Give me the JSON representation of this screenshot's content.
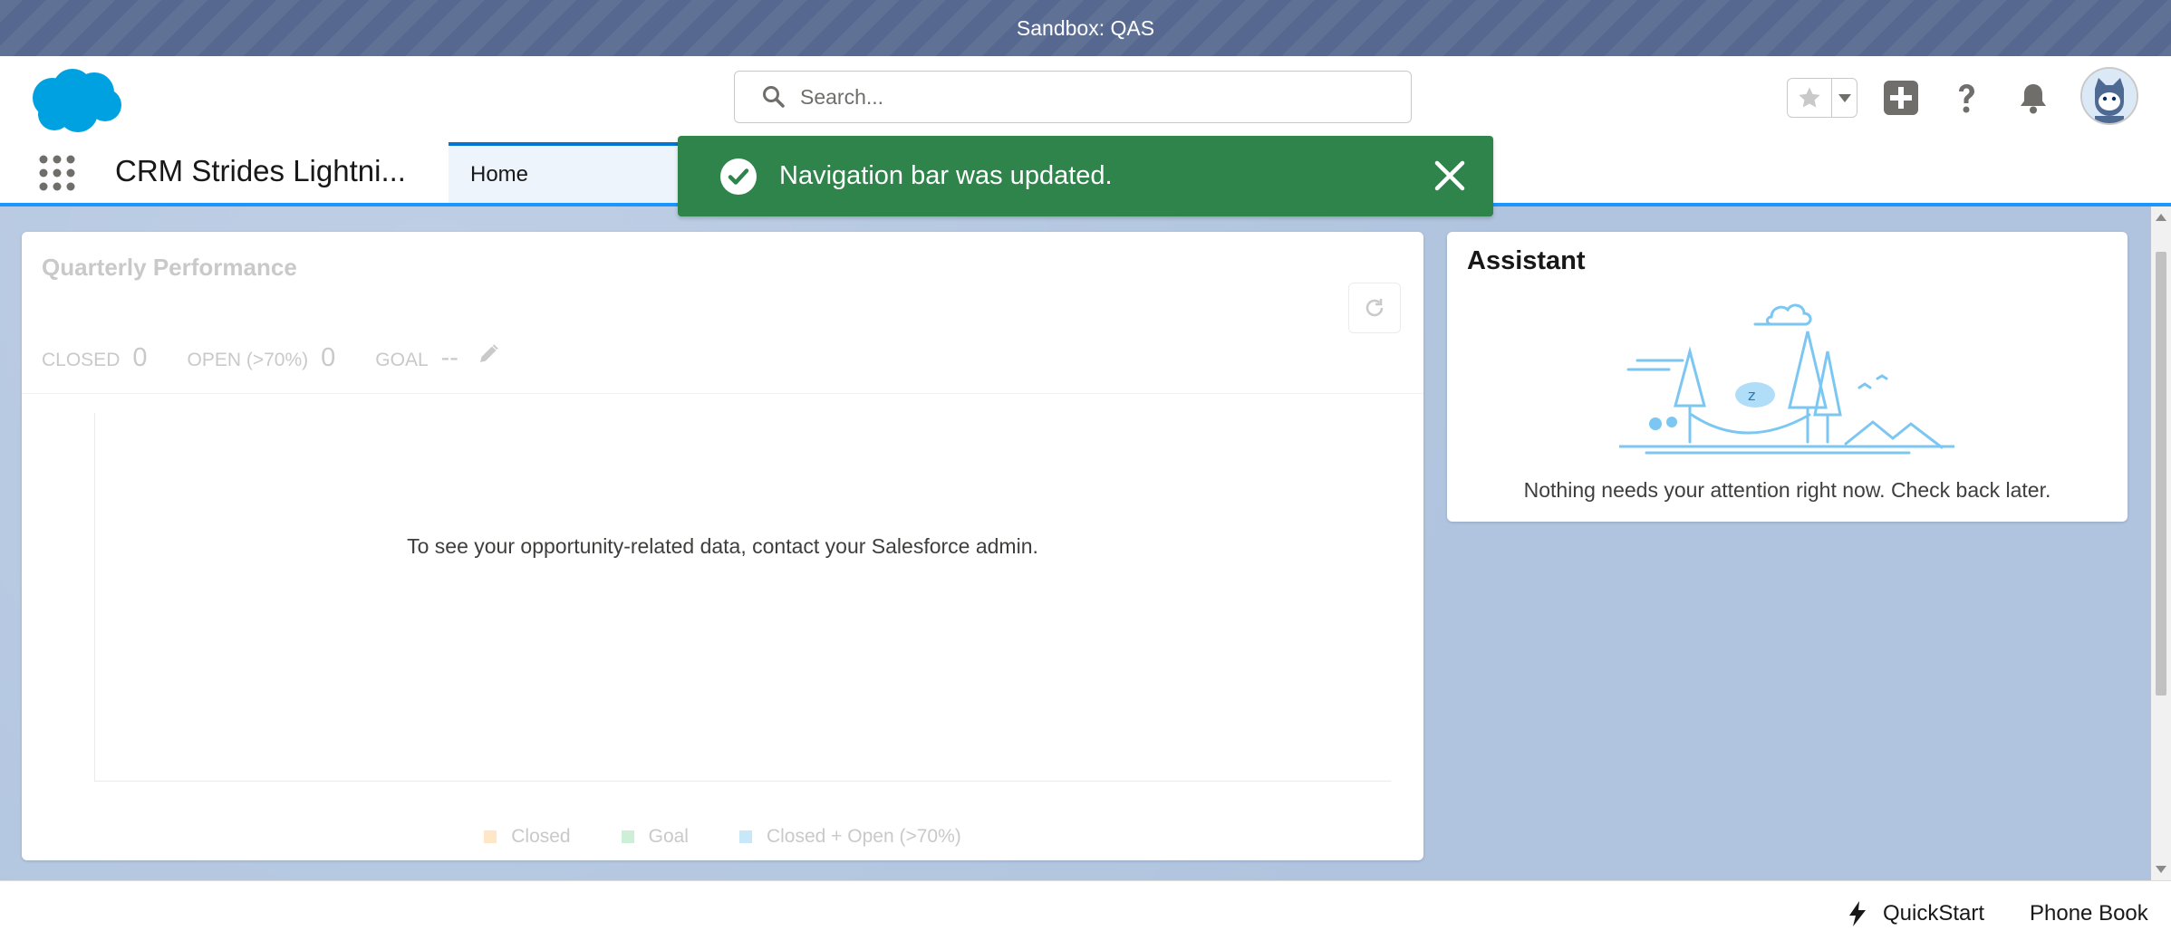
{
  "sandbox": {
    "label": "Sandbox: QAS"
  },
  "header": {
    "search_placeholder": "Search...",
    "icons": [
      "salesforce-logo",
      "star-icon",
      "chevron-down-icon",
      "add-icon",
      "help-icon",
      "bell-icon",
      "avatar"
    ]
  },
  "app_nav": {
    "app_name": "CRM Strides Lightni...",
    "tabs": [
      {
        "label": "Home",
        "active": true
      }
    ]
  },
  "toast": {
    "message": "Navigation bar was updated.",
    "color": "#2e844a"
  },
  "quarterly_performance": {
    "title": "Quarterly Performance",
    "closed_label": "CLOSED",
    "closed_value": "0",
    "open_label": "OPEN (>70%)",
    "open_value": "0",
    "goal_label": "GOAL",
    "goal_value": "--",
    "empty_message": "To see your opportunity-related data, contact your Salesforce admin.",
    "legend": [
      {
        "label": "Closed",
        "color": "#fde7c6"
      },
      {
        "label": "Goal",
        "color": "#cdefd8"
      },
      {
        "label": "Closed + Open (>70%)",
        "color": "#c8e7f8"
      }
    ]
  },
  "assistant": {
    "title": "Assistant",
    "message": "Nothing needs your attention right now. Check back later."
  },
  "utility_bar": {
    "quickstart": "QuickStart",
    "phone_book": "Phone Book"
  },
  "colors": {
    "brand_blue": "#0176d3",
    "sandbox_bar": "#56688f",
    "background": "#b0c4df"
  }
}
